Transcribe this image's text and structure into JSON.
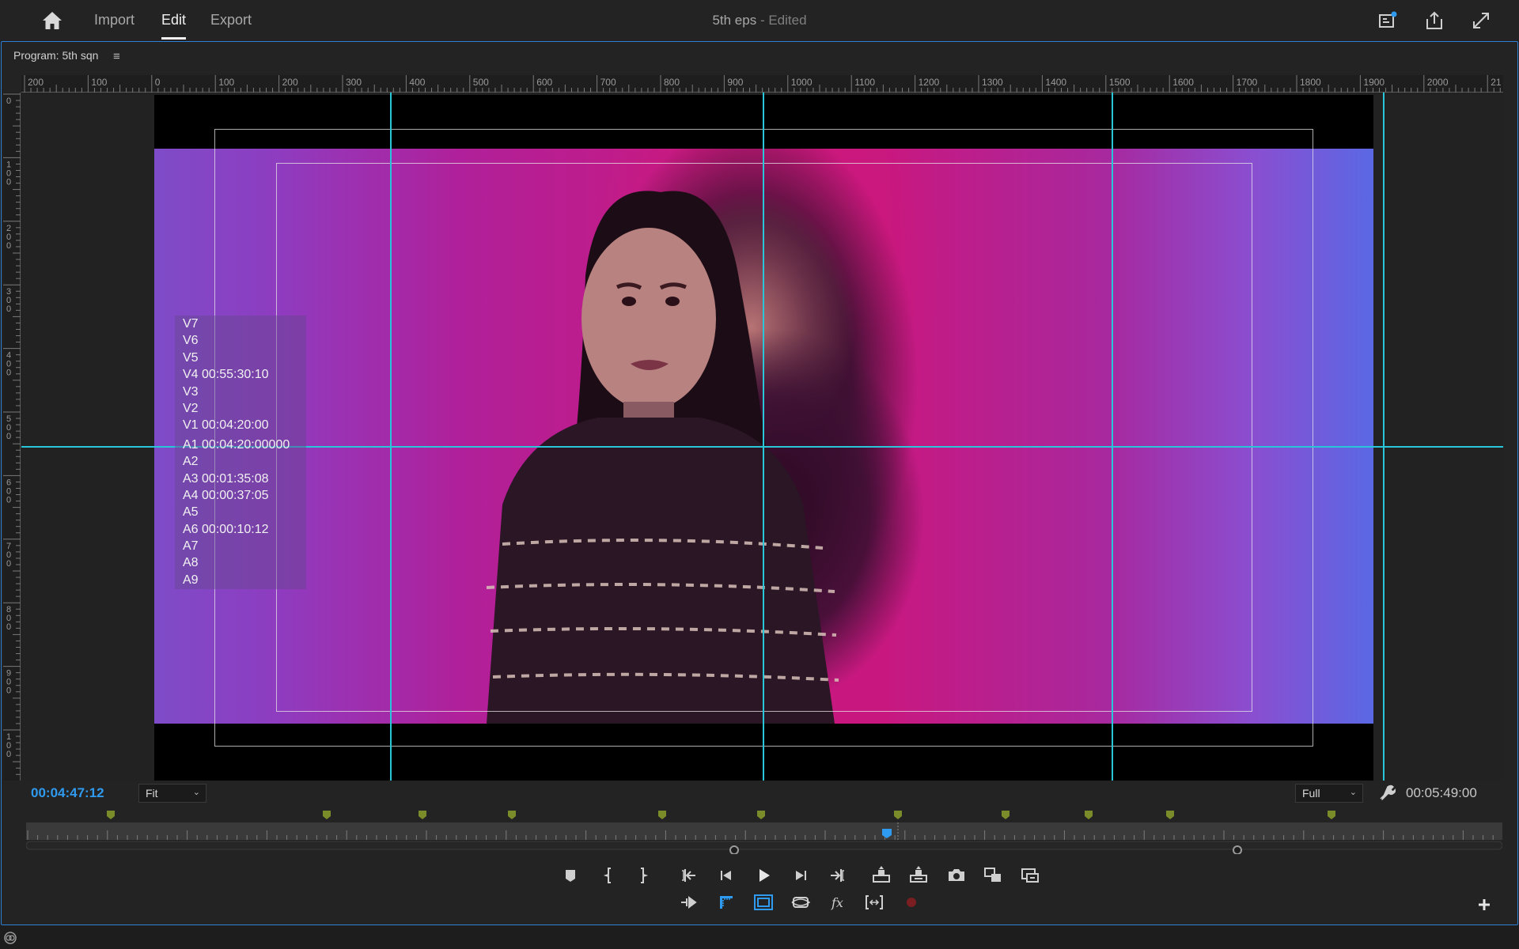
{
  "nav": {
    "home_icon": "home-icon",
    "tabs": [
      {
        "label": "Import",
        "active": false
      },
      {
        "label": "Edit",
        "active": true
      },
      {
        "label": "Export",
        "active": false
      }
    ]
  },
  "document": {
    "name": "5th eps",
    "status": "- Edited"
  },
  "top_icons": [
    "quick-export-icon",
    "share-icon",
    "fullscreen-icon"
  ],
  "panel": {
    "title": "Program: 5th sqn",
    "menu_icon": "hamburger-icon"
  },
  "ruler": {
    "horizontal_labels": [
      "200",
      "100",
      "0",
      "100",
      "200",
      "300",
      "400",
      "500",
      "600",
      "700",
      "800",
      "900",
      "1000",
      "1100",
      "1200",
      "1300",
      "1400",
      "1500",
      "1600",
      "1700",
      "1800",
      "1900",
      "2000",
      "21"
    ],
    "vertical_labels": [
      "0",
      "100",
      "200",
      "300",
      "400",
      "500",
      "600",
      "700",
      "800",
      "900",
      "100"
    ]
  },
  "tracks": [
    "V7",
    "V6",
    "V5",
    "V4 00:55:30:10",
    "V3",
    "V2",
    "V1 00:04:20:00",
    "A1 00:04:20:00000",
    "A2",
    "A3 00:01:35:08",
    "A4 00:00:37:05",
    "A5",
    "A6 00:00:10:12",
    "A7",
    "A8",
    "A9"
  ],
  "playback": {
    "current_timecode": "00:04:47:12",
    "zoom": "Fit",
    "resolution": "Full",
    "duration_timecode": "00:05:49:00",
    "settings_icon": "wrench-icon"
  },
  "colors": {
    "accent": "#2f9bf0",
    "guide": "#29c5d8",
    "marker": "#7a8c2a",
    "panel_border": "#2f7fd6"
  },
  "transport_row1": [
    "add-marker-icon",
    "mark-in-icon",
    "mark-out-icon",
    "go-to-in-icon",
    "step-back-icon",
    "play-icon",
    "step-forward-icon",
    "go-to-out-icon",
    "lift-icon",
    "extract-icon",
    "export-frame-icon",
    "comparison-view-icon",
    "toggle-proxies-icon"
  ],
  "transport_row2": [
    "trim-icon",
    "guides-icon",
    "safe-margins-icon",
    "vr-video-icon",
    "fx-icon",
    "multicam-icon",
    "record-icon"
  ]
}
